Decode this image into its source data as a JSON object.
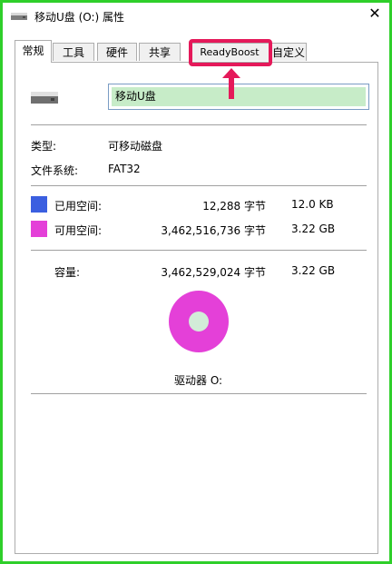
{
  "window": {
    "title": "移动U盘 (O:) 属性",
    "close_glyph": "✕"
  },
  "tabs": [
    {
      "label": "常规",
      "active": true
    },
    {
      "label": "工具",
      "active": false
    },
    {
      "label": "硬件",
      "active": false
    },
    {
      "label": "共享",
      "active": false
    },
    {
      "label": "ReadyBoost",
      "active": false
    },
    {
      "label": "自定义",
      "active": false
    }
  ],
  "general": {
    "volume_name": "移动U盘",
    "type_label": "类型:",
    "type_value": "可移动磁盘",
    "fs_label": "文件系统:",
    "fs_value": "FAT32",
    "used": {
      "label": "已用空间:",
      "bytes": "12,288 字节",
      "size": "12.0 KB",
      "color": "#3b5fe0"
    },
    "free": {
      "label": "可用空间:",
      "bytes": "3,462,516,736 字节",
      "size": "3.22 GB",
      "color": "#e440d8"
    },
    "capacity": {
      "label": "容量:",
      "bytes": "3,462,529,024 字节",
      "size": "3.22 GB"
    },
    "drive_label": "驱动器 O:"
  },
  "annotation": {
    "highlight_color": "#e5195a",
    "highlighted_tab": "ReadyBoost"
  },
  "icons": {
    "title": "usb-drive-icon",
    "drive": "usb-drive-icon",
    "pie": "disk-usage-pie"
  }
}
